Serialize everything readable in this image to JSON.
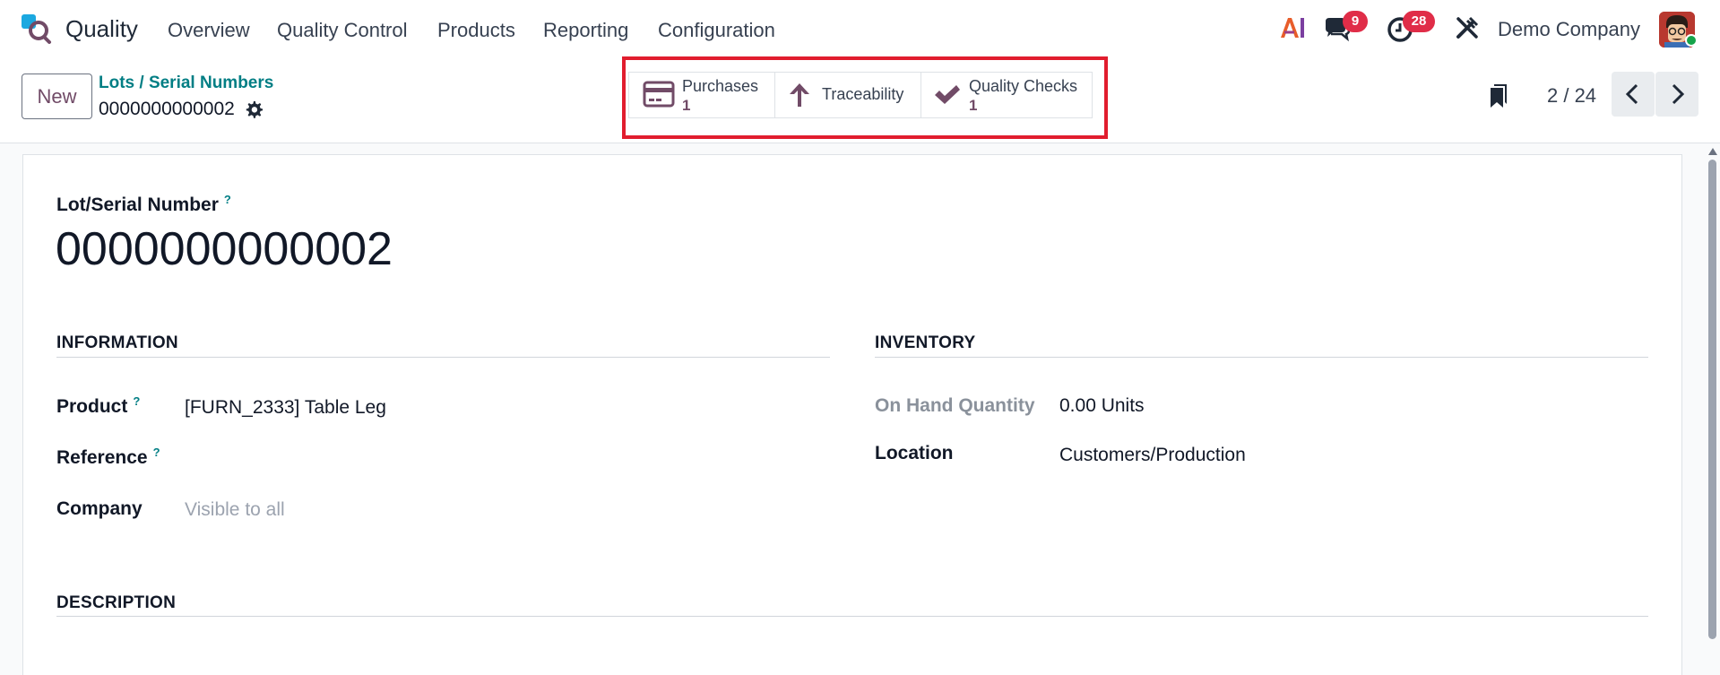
{
  "navbar": {
    "app_name": "Quality",
    "menu": [
      "Overview",
      "Quality Control",
      "Products",
      "Reporting",
      "Configuration"
    ],
    "messages_count": "9",
    "activities_count": "28",
    "company": "Demo Company"
  },
  "control_panel": {
    "new_label": "New",
    "breadcrumb": "Lots / Serial Numbers",
    "record_name": "0000000000002",
    "pager": "2 / 24"
  },
  "smart_buttons": {
    "purchases": {
      "label": "Purchases",
      "value": "1"
    },
    "traceability": {
      "label": "Traceability"
    },
    "quality_checks": {
      "label": "Quality Checks",
      "value": "1"
    }
  },
  "form": {
    "lot_label": "Lot/Serial Number",
    "help_mark": "?",
    "lot_value": "0000000000002",
    "information": {
      "title": "INFORMATION",
      "product_label": "Product",
      "product_value": "[FURN_2333] Table Leg",
      "reference_label": "Reference",
      "company_label": "Company",
      "company_placeholder": "Visible to all"
    },
    "inventory": {
      "title": "INVENTORY",
      "on_hand_label": "On Hand Quantity",
      "on_hand_value": "0.00 Units",
      "location_label": "Location",
      "location_value": "Customers/Production"
    },
    "description_title": "DESCRIPTION"
  },
  "colors": {
    "brand": "#714b67",
    "link": "#017e84",
    "badge": "#e02d48",
    "highlight": "#e11d2e"
  }
}
